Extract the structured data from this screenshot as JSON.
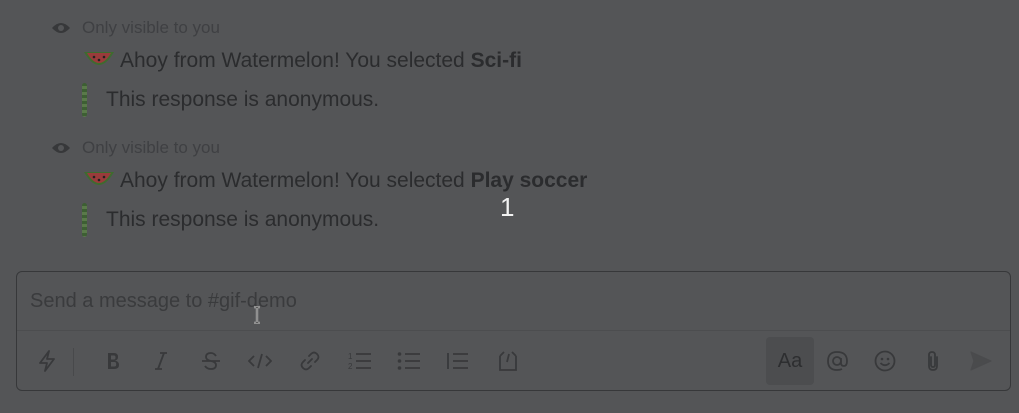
{
  "messages": [
    {
      "visibility": "Only visible to you",
      "prefix": "Ahoy from Watermelon! You selected ",
      "selection": "Sci-fi",
      "attachment": "This response is anonymous."
    },
    {
      "visibility": "Only visible to you",
      "prefix": "Ahoy from Watermelon! You selected ",
      "selection": "Play soccer",
      "attachment": "This response is anonymous."
    }
  ],
  "overlay": {
    "counter": "1"
  },
  "composer": {
    "placeholder": "Send a message to #gif-demo",
    "format_label": "Aa"
  },
  "icons": {
    "eye": "eye-icon",
    "emoji": "watermelon-emoji-icon",
    "toolbar": [
      "shortcuts-icon",
      "bold-icon",
      "italic-icon",
      "strikethrough-icon",
      "code-icon",
      "link-icon",
      "ordered-list-icon",
      "bulleted-list-icon",
      "blockquote-icon",
      "code-block-icon",
      "mention-icon",
      "emoji-picker-icon",
      "attachment-icon",
      "send-icon"
    ]
  },
  "colors": {
    "background": "#545557",
    "attachment_bar": "#4b6a3a"
  }
}
